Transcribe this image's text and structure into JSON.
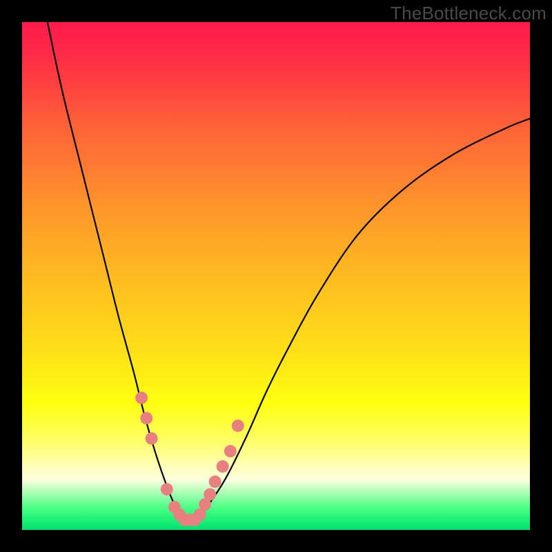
{
  "watermark": "TheBottleneck.com",
  "colors": {
    "background": "#000000",
    "gradient_top": "#ff1a4d",
    "gradient_bottom": "#00e070",
    "curve": "#000000",
    "markers": "#e98080"
  },
  "chart_data": {
    "type": "line",
    "title": "",
    "xlabel": "",
    "ylabel": "",
    "xlim": [
      0,
      100
    ],
    "ylim": [
      0,
      100
    ],
    "grid": false,
    "series": [
      {
        "name": "bottleneck-curve",
        "x": [
          5,
          8,
          12,
          16,
          19,
          22,
          24,
          26,
          28,
          30,
          32,
          34,
          36,
          40,
          44,
          48,
          52,
          58,
          66,
          75,
          85,
          95,
          100
        ],
        "values": [
          100,
          86,
          70,
          54,
          42,
          31,
          23,
          16,
          10,
          5,
          2,
          2,
          4,
          10,
          18,
          27,
          35,
          46,
          58,
          67,
          74,
          79,
          81
        ]
      }
    ],
    "markers": {
      "name": "highlighted-points",
      "x": [
        23.5,
        24.5,
        25.5,
        28.5,
        30.0,
        31.0,
        32.0,
        33.0,
        34.0,
        35.0,
        36.0,
        37.0,
        38.0,
        39.5,
        41.0,
        42.5
      ],
      "values": [
        26.0,
        22.0,
        18.0,
        8.0,
        4.5,
        3.0,
        2.0,
        2.0,
        2.0,
        3.0,
        5.0,
        7.0,
        9.5,
        12.5,
        15.5,
        20.5
      ]
    }
  }
}
